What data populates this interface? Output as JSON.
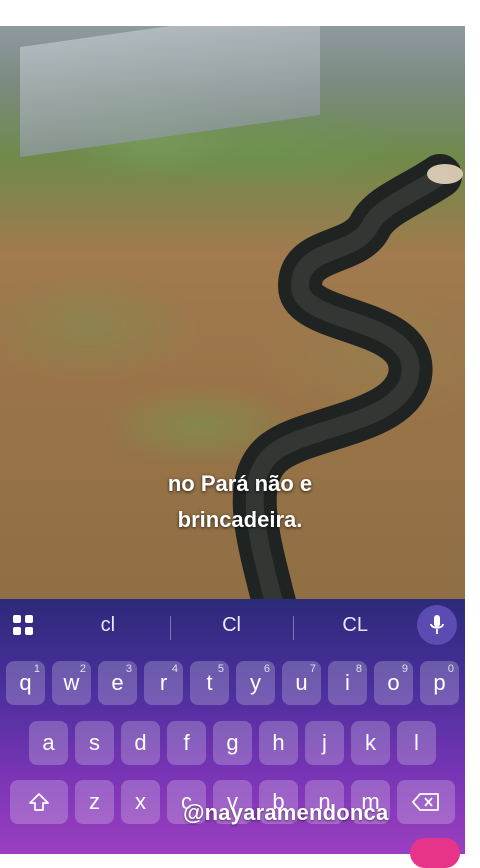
{
  "video": {
    "caption_line1": "no Pará não e",
    "caption_line2": "brincadeira."
  },
  "keyboard": {
    "suggestions": [
      "cl",
      "Cl",
      "CL"
    ],
    "row1": [
      {
        "label": "q",
        "hint": "1"
      },
      {
        "label": "w",
        "hint": "2"
      },
      {
        "label": "e",
        "hint": "3"
      },
      {
        "label": "r",
        "hint": "4"
      },
      {
        "label": "t",
        "hint": "5"
      },
      {
        "label": "y",
        "hint": "6"
      },
      {
        "label": "u",
        "hint": "7"
      },
      {
        "label": "i",
        "hint": "8"
      },
      {
        "label": "o",
        "hint": "9"
      },
      {
        "label": "p",
        "hint": "0"
      }
    ],
    "row2": [
      "a",
      "s",
      "d",
      "f",
      "g",
      "h",
      "j",
      "k",
      "l"
    ],
    "row3": [
      "z",
      "x",
      "c",
      "v",
      "b",
      "n",
      "m"
    ],
    "accent_color": "#e8338a"
  },
  "watermark": "@nayaramendonca"
}
